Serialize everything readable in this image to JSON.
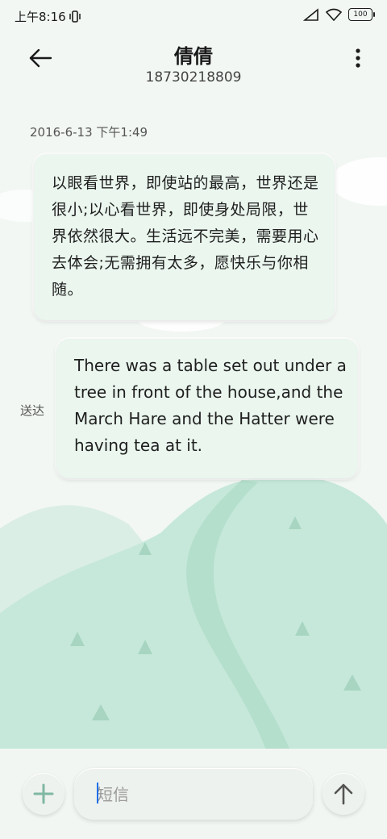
{
  "status_bar": {
    "time": "上午8:16",
    "battery": "100"
  },
  "header": {
    "contact_name": "倩倩",
    "contact_number": "18730218809"
  },
  "conversation": {
    "timestamp": "2016-6-13 下午1:49",
    "messages": [
      {
        "direction": "incoming",
        "text": "以眼看世界，即使站的最高，世界还是很小;以心看世界，即使身处局限，世界依然很大。生活远不完美，需要用心去体会;无需拥有太多，愿快乐与你相随。"
      },
      {
        "direction": "outgoing",
        "text": "There was a table set out under a tree in front of the house,and the March Hare and the Hatter were having tea at it.",
        "status": "送达"
      }
    ]
  },
  "composer": {
    "placeholder": "短信",
    "value": ""
  },
  "colors": {
    "accent": "#7fb8a4",
    "bubble": "#eaf6ee",
    "hill": "#c6e8da"
  }
}
